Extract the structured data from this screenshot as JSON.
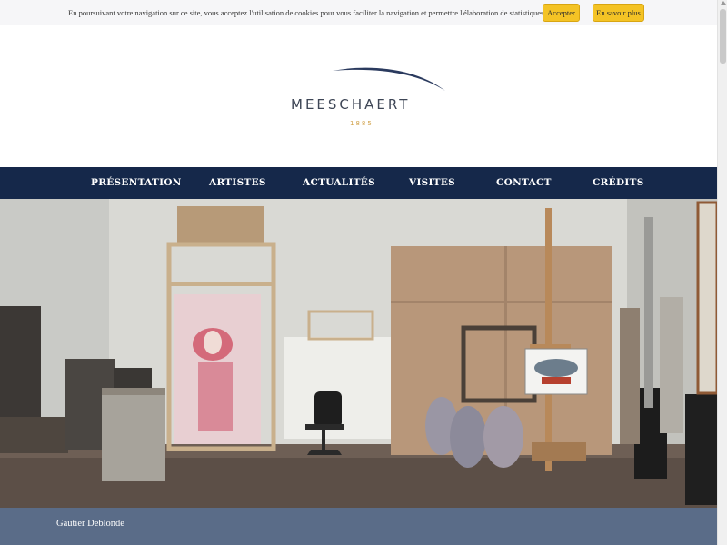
{
  "cookie_bar": {
    "text": "En poursuivant votre navigation sur ce site, vous acceptez l'utilisation de cookies pour vous faciliter la navigation et permettre l'élaboration de statistiques.",
    "accept_label": "Accepter",
    "more_label": "En savoir plus",
    "button_color": "#f4c325"
  },
  "logo": {
    "name": "MEESCHAERT",
    "year": "1885",
    "name_color": "#3e4656",
    "year_color": "#d1a24a"
  },
  "nav": {
    "background": "#15284a",
    "items": [
      {
        "label": "PRÉSENTATION"
      },
      {
        "label": "ARTISTES"
      },
      {
        "label": "ACTUALITÉS"
      },
      {
        "label": "VISITES"
      },
      {
        "label": "CONTACT"
      },
      {
        "label": "CRÉDITS"
      }
    ]
  },
  "hero": {
    "subject": "artist studio photograph"
  },
  "caption": {
    "title": "Gautier Deblonde",
    "background": "#5a6c88"
  }
}
